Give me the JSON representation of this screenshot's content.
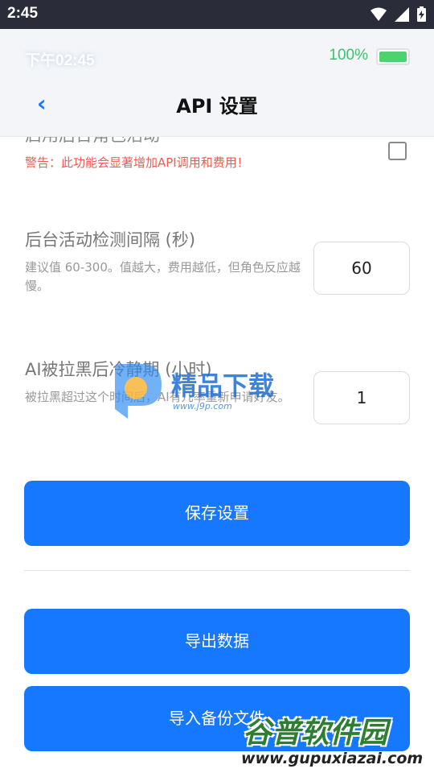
{
  "system_bar": {
    "time": "2:45"
  },
  "app_status": {
    "time": "下午02:45",
    "battery_percent": "100%",
    "battery_level": 1.0
  },
  "header": {
    "back_icon": "‹",
    "title": "API 设置"
  },
  "partial_setting": {
    "label_cut": "启用后台角色活动",
    "warning": "警告：此功能会显著增加API调用和费用！",
    "checked": false
  },
  "settings": [
    {
      "label": "后台活动检测间隔 (秒)",
      "hint": "建议值 60-300。值越大，费用越低，但角色反应越慢。",
      "value": "60"
    },
    {
      "label": "AI被拉黑后冷静期 (小时)",
      "hint": "被拉黑超过这个时间后，AI有几率重新申请好友。",
      "value": "1"
    }
  ],
  "buttons": {
    "save": "保存设置",
    "export": "导出数据",
    "import": "导入备份文件"
  },
  "watermarks": {
    "j9p_text": "精品下载",
    "j9p_url": "www.j9p.com",
    "gupu_text": "谷普软件园",
    "gupu_url": "www.gupuxiazai.com"
  },
  "colors": {
    "accent": "#1677ff",
    "warning": "#f05a50",
    "battery": "#4fd16f"
  }
}
